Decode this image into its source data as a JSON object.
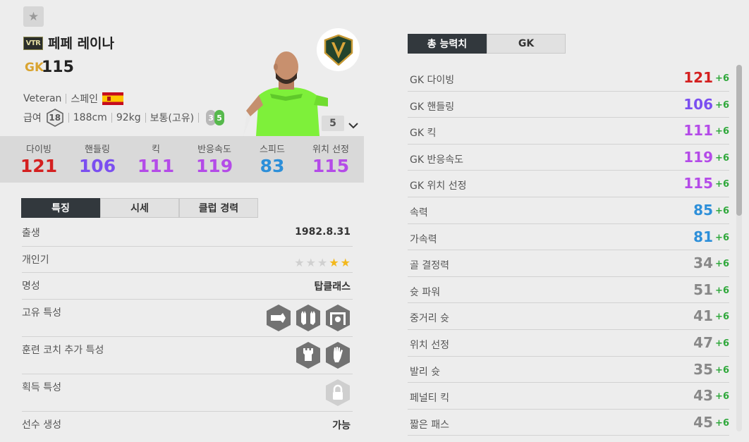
{
  "header": {
    "favorite_icon": "star-icon",
    "season_badge": "VTR",
    "player_name": "페페 레이나",
    "position": "GK",
    "overall": "115",
    "season_name": "Veteran",
    "nationality": "스페인",
    "salary_label": "급여",
    "salary": "18",
    "height": "188cm",
    "weight": "92kg",
    "body_type": "보통(고유)",
    "weak_foot": "3",
    "skill_moves": "5",
    "grade": "5"
  },
  "summary_stats": [
    {
      "label": "다이빙",
      "value": "121",
      "color": "#d42020"
    },
    {
      "label": "핸들링",
      "value": "106",
      "color": "#7b4ff0"
    },
    {
      "label": "킥",
      "value": "111",
      "color": "#b44be8"
    },
    {
      "label": "반응속도",
      "value": "119",
      "color": "#b44be8"
    },
    {
      "label": "스피드",
      "value": "83",
      "color": "#2d8fd9"
    },
    {
      "label": "위치 선정",
      "value": "115",
      "color": "#b44be8"
    }
  ],
  "left_tabs": [
    "특징",
    "시세",
    "클럽 경력"
  ],
  "details": {
    "birth_label": "출생",
    "birth": "1982.8.31",
    "popularity_label": "개인기",
    "popularity_stars": 2,
    "reputation_label": "명성",
    "reputation": "탑클래스",
    "traits_label": "고유 특성",
    "coach_traits_label": "훈련 코치 추가 특성",
    "acquired_traits_label": "획득 특성",
    "creation_label": "선수 생성",
    "creation": "가능"
  },
  "right_tabs": [
    "총 능력치",
    "GK"
  ],
  "attributes": [
    {
      "name": "GK 다이빙",
      "value": "121",
      "bonus": "+6",
      "color": "#d42020"
    },
    {
      "name": "GK 핸들링",
      "value": "106",
      "bonus": "+6",
      "color": "#7b4ff0"
    },
    {
      "name": "GK 킥",
      "value": "111",
      "bonus": "+6",
      "color": "#b44be8"
    },
    {
      "name": "GK 반응속도",
      "value": "119",
      "bonus": "+6",
      "color": "#b44be8"
    },
    {
      "name": "GK 위치 선정",
      "value": "115",
      "bonus": "+6",
      "color": "#b44be8"
    },
    {
      "name": "속력",
      "value": "85",
      "bonus": "+6",
      "color": "#2d8fd9"
    },
    {
      "name": "가속력",
      "value": "81",
      "bonus": "+6",
      "color": "#2d8fd9"
    },
    {
      "name": "골 결정력",
      "value": "34",
      "bonus": "+6",
      "color": "#888888"
    },
    {
      "name": "슛 파워",
      "value": "51",
      "bonus": "+6",
      "color": "#888888"
    },
    {
      "name": "중거리 슛",
      "value": "41",
      "bonus": "+6",
      "color": "#888888"
    },
    {
      "name": "위치 선정",
      "value": "47",
      "bonus": "+6",
      "color": "#888888"
    },
    {
      "name": "발리 슛",
      "value": "35",
      "bonus": "+6",
      "color": "#888888"
    },
    {
      "name": "페널티 킥",
      "value": "43",
      "bonus": "+6",
      "color": "#888888"
    },
    {
      "name": "짧은 패스",
      "value": "45",
      "bonus": "+6",
      "color": "#888888"
    }
  ]
}
